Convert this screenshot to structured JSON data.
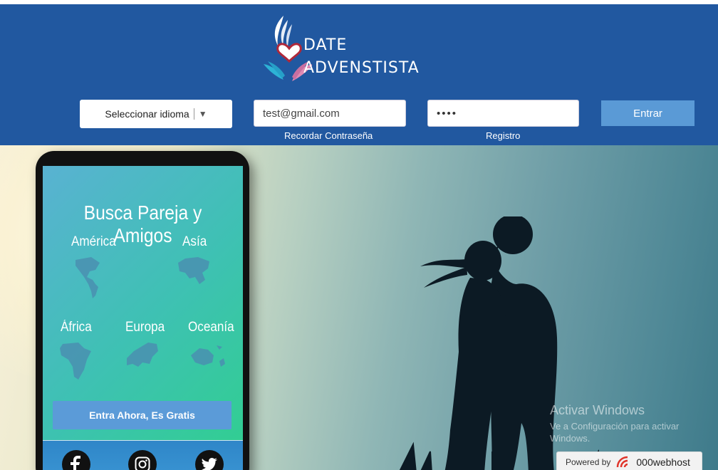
{
  "logo": {
    "line1": "DATE",
    "line2": "ADVENSTISTA"
  },
  "header": {
    "language_select": {
      "selected": "Seleccionar idioma"
    },
    "email": {
      "value": "test@gmail.com"
    },
    "password": {
      "value": "••••"
    },
    "login_button": "Entrar",
    "remember_link": "Recordar Contraseña",
    "register_link": "Registro"
  },
  "phone": {
    "title": "Busca Pareja y Amigos",
    "regions": [
      "América",
      "Asía",
      "África",
      "Europa",
      "Oceanía"
    ],
    "cta": "Entra Ahora, Es Gratis",
    "social": [
      "facebook-icon",
      "instagram-icon",
      "twitter-icon"
    ]
  },
  "watermark": {
    "line1": "Activar Windows",
    "line2": "Ve a Configuración para activar",
    "line3": "Windows."
  },
  "powered": {
    "label": "Powered by",
    "brand": "000webhost"
  },
  "colors": {
    "header": "#2158a0",
    "button": "#5a9ad6",
    "cta": "#5b9bd8"
  }
}
